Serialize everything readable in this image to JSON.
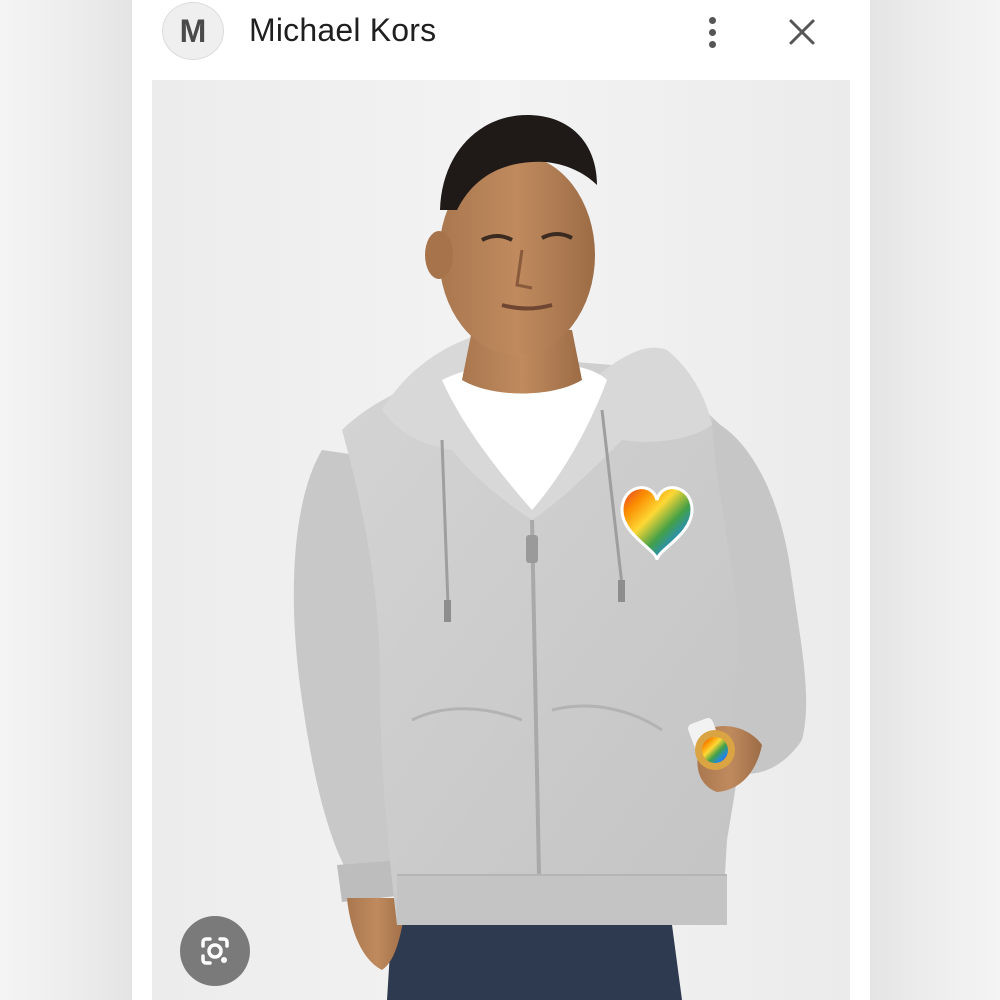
{
  "header": {
    "avatar_letter": "M",
    "title": "Michael Kors"
  },
  "icons": {
    "more": "more-vert-icon",
    "close": "close-icon",
    "lens": "google-lens-icon"
  },
  "colors": {
    "hoodie": "#cfcfcf",
    "background": "#f1f1f1",
    "jeans": "#2e3a4f"
  }
}
